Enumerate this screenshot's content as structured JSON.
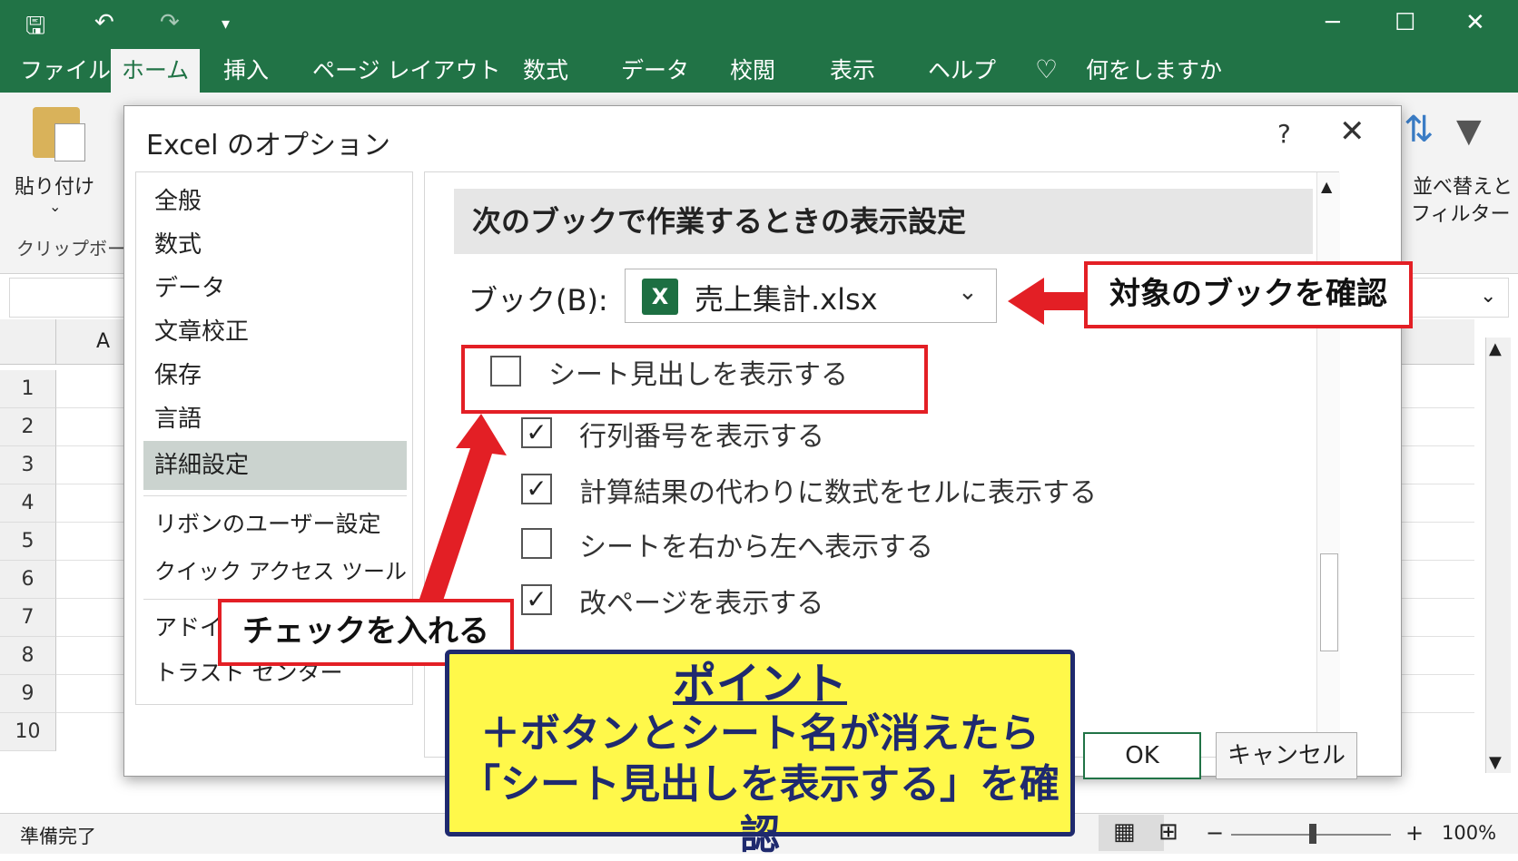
{
  "titlebar": {
    "save_icon": "save-icon",
    "undo_icon": "undo-icon",
    "redo_icon": "redo-icon",
    "customize_icon": "qat-dropdown-icon"
  },
  "tabs": [
    "ファイル",
    "ホーム",
    "挿入",
    "ページ レイアウト",
    "数式",
    "データ",
    "校閲",
    "表示",
    "ヘルプ"
  ],
  "tell_me": "何をしますか",
  "ribbon": {
    "paste": "貼り付け",
    "clipboard": "クリップボード",
    "sort_filter_1": "並べ替えと",
    "sort_filter_2": "フィルター"
  },
  "grid": {
    "col_a": "A",
    "rows": [
      "1",
      "2",
      "3",
      "4",
      "5",
      "6",
      "7",
      "8",
      "9",
      "10"
    ]
  },
  "status": {
    "ready": "準備完了",
    "zoom": "100%"
  },
  "dialog": {
    "title": "Excel のオプション",
    "help": "?",
    "nav": [
      "全般",
      "数式",
      "データ",
      "文章校正",
      "保存",
      "言語",
      "詳細設定",
      "リボンのユーザー設定",
      "クイック アクセス ツール バー",
      "アドイン",
      "トラスト センター"
    ],
    "section_header": "次のブックで作業するときの表示設定",
    "book_label": "ブック(B):",
    "book_value": "売上集計.xlsx",
    "options": [
      {
        "label": "シート見出しを表示する",
        "checked": false
      },
      {
        "label": "行列番号を表示する",
        "checked": true
      },
      {
        "label": "計算結果の代わりに数式をセルに表示する",
        "checked": true
      },
      {
        "label": "シートを右から左へ表示する",
        "checked": false
      },
      {
        "label": "改ページを表示する",
        "checked": true
      }
    ],
    "ok": "OK",
    "cancel": "キャンセル"
  },
  "annotations": {
    "callout_book": "対象のブックを確認",
    "callout_check": "チェックを入れる",
    "point_title": "ポイント",
    "point_line1": "＋ボタンとシート名が消えたら",
    "point_line2": "「シート見出しを表示する」を確認"
  },
  "colors": {
    "excel_green": "#217346",
    "annotation_red": "#e31f25",
    "point_yellow": "#fff84a",
    "point_navy": "#1f2a6e"
  }
}
